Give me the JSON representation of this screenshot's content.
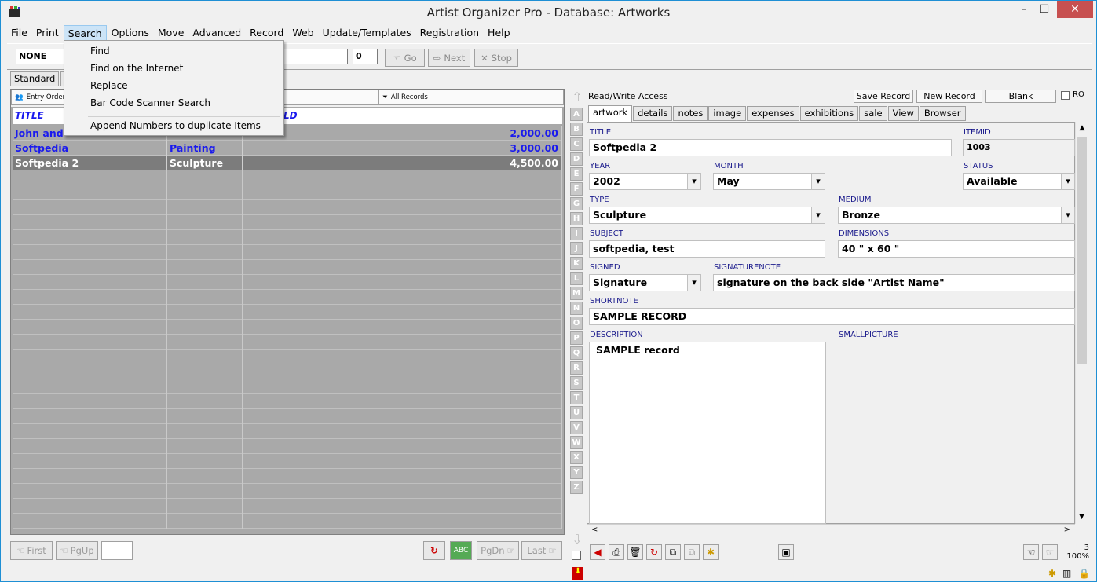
{
  "window": {
    "title": "Artist Organizer Pro - Database: Artworks",
    "min_glyph": "–",
    "max_glyph": "☐",
    "close_glyph": "✕"
  },
  "menu": [
    "File",
    "Print",
    "Search",
    "Options",
    "Move",
    "Advanced",
    "Record",
    "Web",
    "Update/Templates",
    "Registration",
    "Help"
  ],
  "search_menu": {
    "items": [
      "Find",
      "Find on the Internet",
      "Replace",
      "Bar Code Scanner Search",
      "Append Numbers to duplicate Items"
    ]
  },
  "toolbar": {
    "field_value": "NONE",
    "count_value": "0",
    "go_label": "Go",
    "next_label": "Next",
    "stop_label": "Stop"
  },
  "view_tabs": [
    "Standard",
    "A"
  ],
  "list_header": {
    "entry_order": "Entry Order",
    "all_records": "All Records"
  },
  "columns": {
    "title": "TITLE",
    "third": "LD"
  },
  "rows": [
    {
      "title": "John and",
      "type": "",
      "price": "2,000.00"
    },
    {
      "title": "Softpedia",
      "type": "Painting",
      "price": "3,000.00"
    },
    {
      "title": "Softpedia 2",
      "type": "Sculpture",
      "price": "4,500.00"
    }
  ],
  "nav": {
    "first": "First",
    "pgup": "PgUp",
    "pgdn": "PgDn",
    "last": "Last"
  },
  "alphabet": [
    "A",
    "B",
    "C",
    "D",
    "E",
    "F",
    "G",
    "H",
    "I",
    "J",
    "K",
    "L",
    "M",
    "N",
    "O",
    "P",
    "Q",
    "R",
    "S",
    "T",
    "U",
    "V",
    "W",
    "X",
    "Y",
    "Z"
  ],
  "record_bar": {
    "access": "Read/Write Access",
    "save": "Save Record",
    "new": "New Record",
    "blank": "Blank",
    "ro": "RO"
  },
  "record_tabs": [
    "artwork",
    "details",
    "notes",
    "image",
    "expenses",
    "exhibitions",
    "sale",
    "View",
    "Browser"
  ],
  "form": {
    "title_label": "TITLE",
    "title": "Softpedia 2",
    "itemid_label": "ITEMID",
    "itemid": "1003",
    "year_label": "YEAR",
    "year": "2002",
    "month_label": "MONTH",
    "month": "May",
    "status_label": "STATUS",
    "status": "Available",
    "type_label": "TYPE",
    "type": "Sculpture",
    "medium_label": "MEDIUM",
    "medium": "Bronze",
    "subject_label": "SUBJECT",
    "subject": "softpedia, test",
    "dimensions_label": "DIMENSIONS",
    "dimensions": "40 \" x 60 \"",
    "signed_label": "SIGNED",
    "signed": "Signature",
    "signaturenote_label": "SIGNATURENOTE",
    "signaturenote": "signature on the back side \"Artist Name\"",
    "shortnote_label": "SHORTNOTE",
    "shortnote": "SAMPLE RECORD",
    "description_label": "DESCRIPTION",
    "description": "SAMPLE record",
    "smallpicture_label": "SMALLPICTURE"
  },
  "zoom": {
    "count": "3",
    "percent": "100%"
  }
}
